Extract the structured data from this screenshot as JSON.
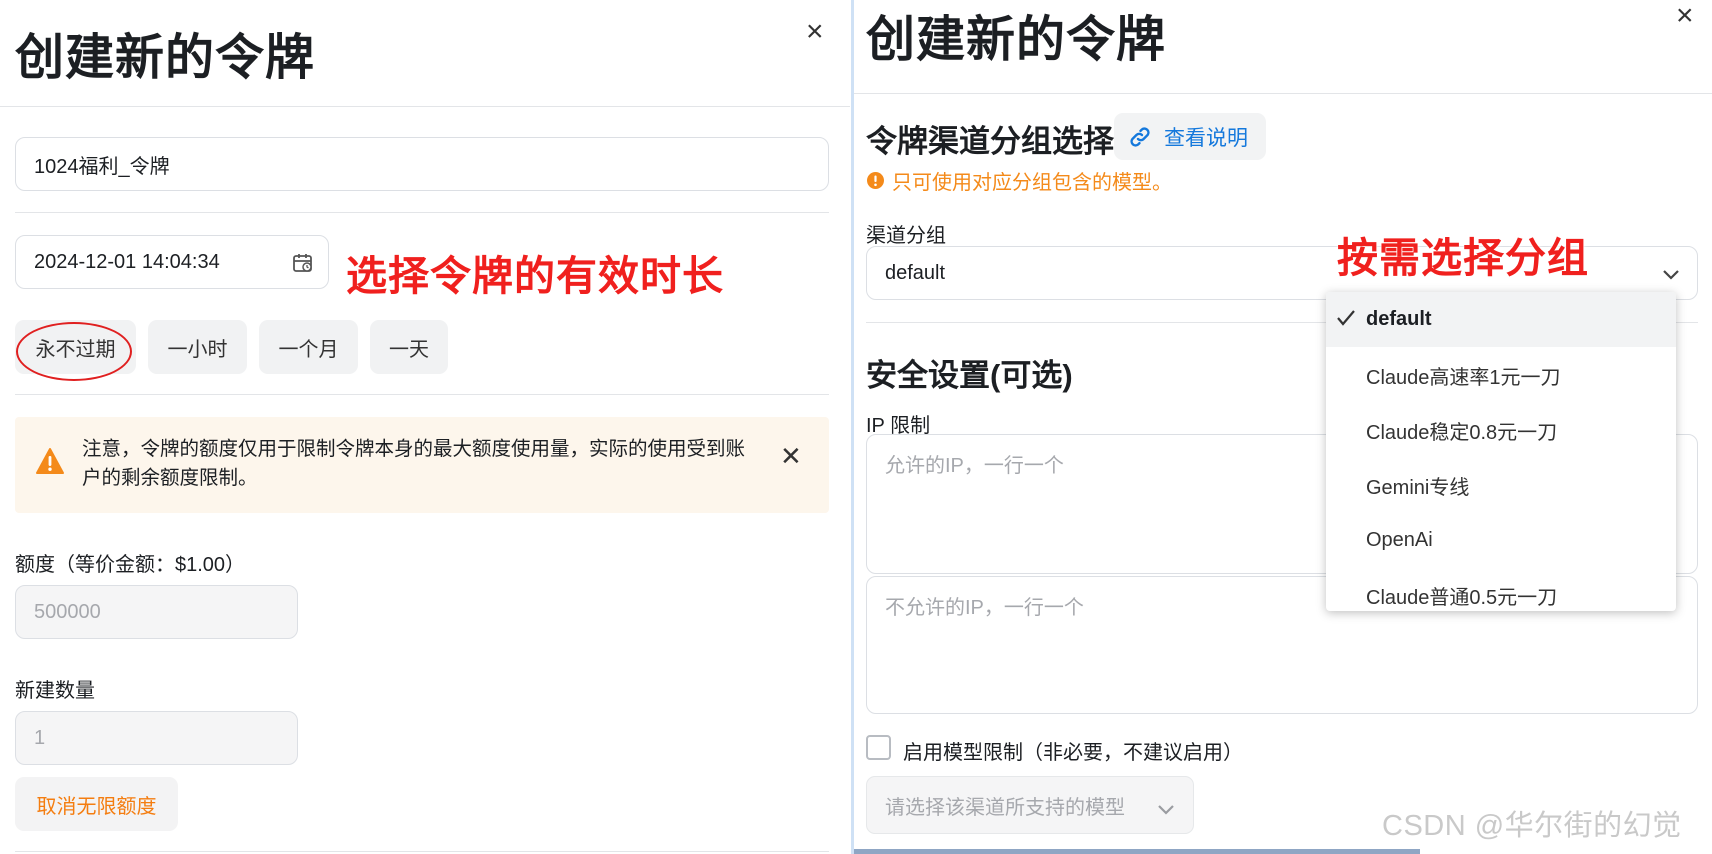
{
  "left": {
    "title": "创建新的令牌",
    "close": "×",
    "name_value": "1024福利_令牌",
    "date_value": "2024-12-01 14:04:34",
    "expire_annotation": "选择令牌的有效时长",
    "expire_options": [
      "永不过期",
      "一小时",
      "一个月",
      "一天"
    ],
    "warning_text": "注意，令牌的额度仅用于限制令牌本身的最大额度使用量，实际的使用受到账户的剩余额度限制。",
    "warning_close": "✕",
    "quota_label": "额度（等价金额：$1.00）",
    "quota_value": "500000",
    "count_label": "新建数量",
    "count_value": "1",
    "unlimited_button": "取消无限额度"
  },
  "right": {
    "title": "创建新的令牌",
    "close": "×",
    "group_section_title": "令牌渠道分组选择",
    "view_docs_link": "查看说明",
    "group_hint": "只可使用对应分组包含的模型。",
    "group_label": "渠道分组",
    "group_value": "default",
    "group_annotation": "按需选择分组",
    "group_options": [
      "default",
      "Claude高速率1元一刀",
      "Claude稳定0.8元一刀",
      "Gemini专线",
      "OpenAi",
      "Claude普通0.5元一刀"
    ],
    "security_title": "安全设置(可选)",
    "ip_label": "IP 限制",
    "ip_allow_placeholder": "允许的IP，一行一个",
    "ip_deny_placeholder": "不允许的IP，一行一个",
    "model_limit_label": "启用模型限制（非必要，不建议启用）",
    "model_select_placeholder": "请选择该渠道所支持的模型"
  },
  "watermark": "CSDN @华尔街的幻觉",
  "colors": {
    "annotation_red": "#f0201e",
    "link_blue": "#1478dc",
    "warning_orange": "#f47d10",
    "warning_bg": "#fdf6ec"
  }
}
